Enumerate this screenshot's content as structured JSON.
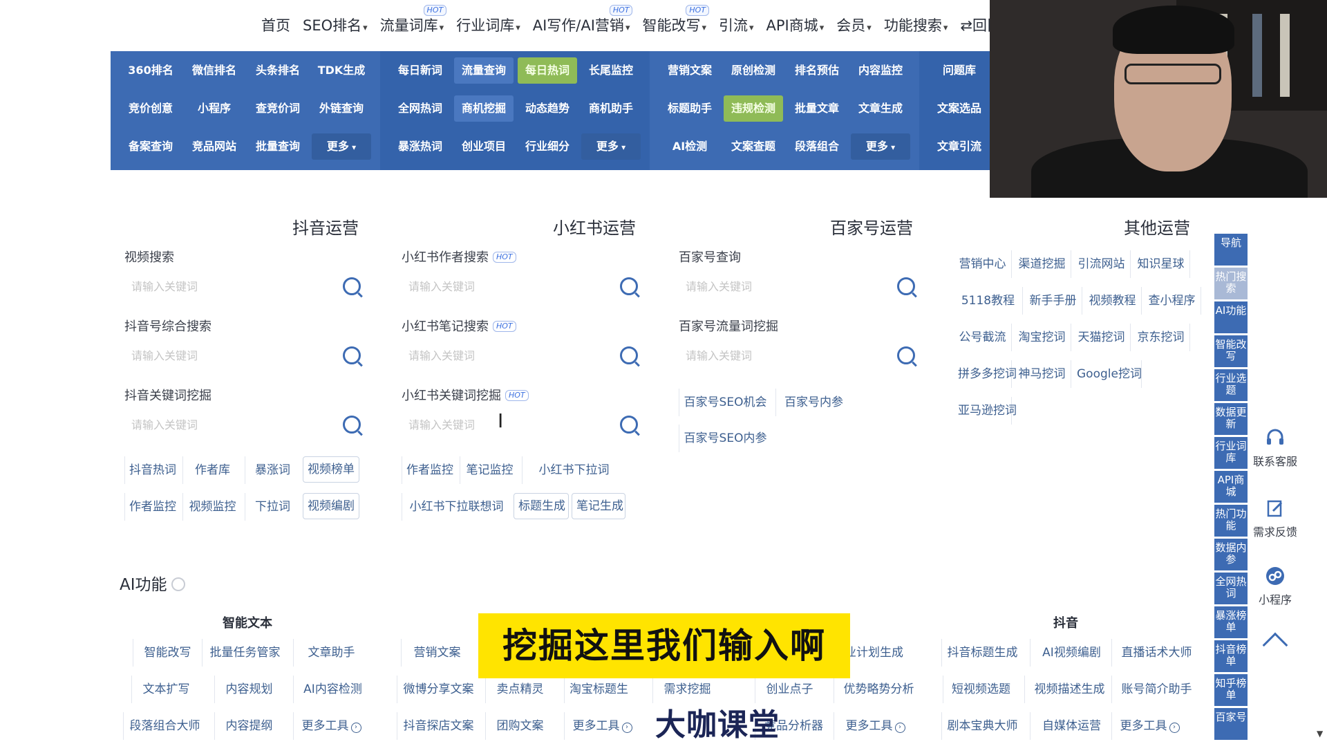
{
  "nav": {
    "items": [
      {
        "label": "首页",
        "caret": false,
        "hot": false
      },
      {
        "label": "SEO排名",
        "caret": true,
        "hot": false
      },
      {
        "label": "流量词库",
        "caret": true,
        "hot": true
      },
      {
        "label": "行业词库",
        "caret": true,
        "hot": false
      },
      {
        "label": "AI写作/AI营销",
        "caret": true,
        "hot": true
      },
      {
        "label": "智能改写",
        "caret": true,
        "hot": true
      },
      {
        "label": "引流",
        "caret": true,
        "hot": false
      },
      {
        "label": "API商城",
        "caret": true,
        "hot": false
      },
      {
        "label": "会员",
        "caret": true,
        "hot": false
      },
      {
        "label": "功能搜索",
        "caret": true,
        "hot": false
      },
      {
        "label": "⇄回旧版",
        "caret": false,
        "hot": false
      }
    ],
    "hot_label": "HOT"
  },
  "banner": {
    "groups": [
      [
        "360排名",
        "微信排名",
        "头条排名",
        "TDK生成",
        "竞价创意",
        "小程序",
        "查竞价词",
        "外链查询",
        "备案查询",
        "竞品网站",
        "批量查询",
        "更多"
      ],
      [
        "每日新词",
        "流量查询",
        "每日热词",
        "长尾监控",
        "全网热词",
        "商机挖掘",
        "动态趋势",
        "商机助手",
        "暴涨热词",
        "创业项目",
        "行业细分",
        "更多"
      ],
      [
        "营销文案",
        "原创检测",
        "排名预估",
        "内容监控",
        "标题助手",
        "违规检测",
        "批量文章",
        "文章生成",
        "AI检测",
        "文案查题",
        "段落组合",
        "更多"
      ],
      [
        "问题库",
        "",
        "文案选品",
        "",
        "文章引流",
        ""
      ]
    ]
  },
  "columns": {
    "douyin": {
      "title": "抖音运营",
      "searches": [
        {
          "label": "视频搜索",
          "placeholder": "请输入关键词"
        },
        {
          "label": "抖音号综合搜索",
          "placeholder": "请输入关键词"
        },
        {
          "label": "抖音关键词挖掘",
          "placeholder": "请输入关键词"
        }
      ],
      "chips_row1": [
        "抖音热词",
        "作者库",
        "暴涨词",
        "视频榜单"
      ],
      "chips_row2": [
        "作者监控",
        "视频监控",
        "下拉词",
        "视频编剧"
      ]
    },
    "xhs": {
      "title": "小红书运营",
      "searches": [
        {
          "label": "小红书作者搜索",
          "placeholder": "请输入关键词"
        },
        {
          "label": "小红书笔记搜索",
          "placeholder": "请输入关键词"
        },
        {
          "label": "小红书关键词挖掘",
          "placeholder": "请输入关键词"
        }
      ],
      "chips_row1": [
        "作者监控",
        "笔记监控",
        "小红书下拉词"
      ],
      "chips_row2": [
        "小红书下拉联想词",
        "标题生成",
        "笔记生成"
      ]
    },
    "baijia": {
      "title": "百家号运营",
      "searches": [
        {
          "label": "百家号查询",
          "placeholder": "请输入关键词"
        },
        {
          "label": "百家号流量词挖掘",
          "placeholder": "请输入关键词"
        }
      ],
      "chips": [
        "百家号SEO机会",
        "百家号内参",
        "百家号SEO内参"
      ]
    },
    "other": {
      "title": "其他运营",
      "chips": [
        "营销中心",
        "渠道挖掘",
        "引流网站",
        "知识星球",
        "5118教程",
        "新手手册",
        "视频教程",
        "查小程序",
        "公号截流",
        "淘宝挖词",
        "天猫挖词",
        "京东挖词",
        "拼多多挖词",
        "神马挖词",
        "Google挖词",
        "亚马逊挖词"
      ]
    }
  },
  "ai": {
    "title": "AI功能",
    "sub_text": "智能文本",
    "sub_douyin": "抖音",
    "row1": [
      "智能改写",
      "批量任务管家",
      "文章助手",
      "营销文案",
      "业计划生成",
      "抖音标题生成",
      "AI视频编剧",
      "直播话术大师"
    ],
    "row2": [
      "文本扩写",
      "内容规划",
      "AI内容检测",
      "微博分享文案",
      "卖点精灵",
      "淘宝标题生",
      "需求挖掘",
      "创业点子",
      "优势略势分析",
      "短视频选题",
      "视频描述生成",
      "账号简介助手"
    ],
    "row3": [
      "段落组合大师",
      "内容提纲",
      "更多工具",
      "抖音探店文案",
      "团购文案",
      "更多工具",
      "竞品分析器",
      "更多工具",
      "剧本宝典大师",
      "自媒体运营",
      "更多工具"
    ]
  },
  "subtitle": "挖掘这里我们输入啊",
  "logo": "大咖课堂",
  "sidebar": {
    "items": [
      "导航",
      "热门搜索",
      "AI功能",
      "智能改写",
      "行业选题",
      "数据更新",
      "行业词库",
      "API商城",
      "热门功能",
      "数据内参",
      "全网热词",
      "暴涨榜单",
      "抖音榜单",
      "知乎榜单",
      "百家号"
    ],
    "tools": [
      "联系客服",
      "需求反馈",
      "小程序"
    ]
  }
}
